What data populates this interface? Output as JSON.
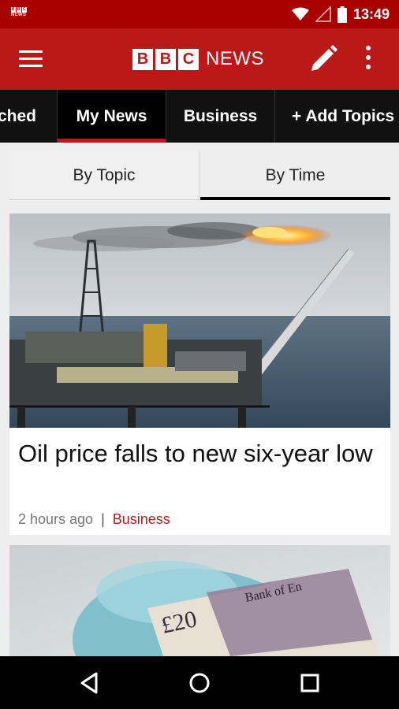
{
  "status_bar": {
    "time": "13:49",
    "logo_top": "BBC",
    "logo_bottom": "NEWS"
  },
  "toolbar": {
    "brand_letters": [
      "B",
      "B",
      "C"
    ],
    "brand_word": "NEWS",
    "brand_color": "#bb1919"
  },
  "tabs": [
    {
      "label": "tched",
      "active": false
    },
    {
      "label": "My News",
      "active": true
    },
    {
      "label": "Business",
      "active": false
    },
    {
      "label": "+ Add Topics",
      "active": false
    }
  ],
  "view_toggle": {
    "left": "By Topic",
    "right": "By Time",
    "selected": "By Time"
  },
  "articles": [
    {
      "headline": "Oil price falls to new six-year low",
      "time": "2 hours ago",
      "separator": "|",
      "topic": "Business",
      "image": "oil-platform-photo"
    },
    {
      "image": "banknote-piggybank-photo",
      "note_value": "£20",
      "note_bank_text": "Bank of En"
    }
  ],
  "icons": [
    "hamburger-menu-icon",
    "edit-pencil-icon",
    "more-vert-icon",
    "wifi-icon",
    "cellular-icon",
    "battery-icon",
    "back-icon",
    "home-icon",
    "recents-icon"
  ]
}
